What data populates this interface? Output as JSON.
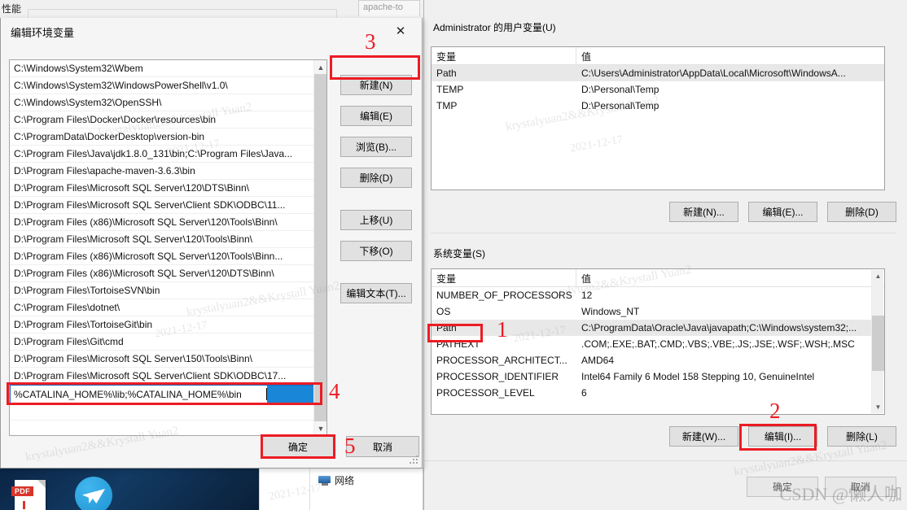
{
  "background": {
    "perf_label": "性能",
    "tab_label": "apache-to",
    "explorer_tree_item": "网络",
    "pdf_icon_label": "PDF"
  },
  "env_dialog": {
    "user_group_label": "Administrator 的用户变量(U)",
    "system_group_label": "系统变量(S)",
    "columns": {
      "variable": "变量",
      "value": "值"
    },
    "user_variables": [
      {
        "name": "Path",
        "value": "C:\\Users\\Administrator\\AppData\\Local\\Microsoft\\WindowsA...",
        "selected": true
      },
      {
        "name": "TEMP",
        "value": "D:\\Personal\\Temp",
        "selected": false
      },
      {
        "name": "TMP",
        "value": "D:\\Personal\\Temp",
        "selected": false
      }
    ],
    "user_buttons": {
      "new": "新建(N)...",
      "edit": "编辑(E)...",
      "delete": "删除(D)"
    },
    "system_variables": [
      {
        "name": "NUMBER_OF_PROCESSORS",
        "value": "12",
        "selected": false
      },
      {
        "name": "OS",
        "value": "Windows_NT",
        "selected": false
      },
      {
        "name": "Path",
        "value": "C:\\ProgramData\\Oracle\\Java\\javapath;C:\\Windows\\system32;...",
        "selected": true
      },
      {
        "name": "PATHEXT",
        "value": ".COM;.EXE;.BAT;.CMD;.VBS;.VBE;.JS;.JSE;.WSF;.WSH;.MSC",
        "selected": false
      },
      {
        "name": "PROCESSOR_ARCHITECT...",
        "value": "AMD64",
        "selected": false
      },
      {
        "name": "PROCESSOR_IDENTIFIER",
        "value": "Intel64 Family 6 Model 158 Stepping 10, GenuineIntel",
        "selected": false
      },
      {
        "name": "PROCESSOR_LEVEL",
        "value": "6",
        "selected": false
      }
    ],
    "system_buttons": {
      "new": "新建(W)...",
      "edit": "编辑(I)...",
      "delete": "删除(L)"
    },
    "footer_buttons": {
      "ok": "确定",
      "cancel": "取消"
    }
  },
  "edit_dialog": {
    "title": "编辑环境变量",
    "close_icon": "✕",
    "path_entries": [
      "C:\\Windows\\System32\\Wbem",
      "C:\\Windows\\System32\\WindowsPowerShell\\v1.0\\",
      "C:\\Windows\\System32\\OpenSSH\\",
      "C:\\Program Files\\Docker\\Docker\\resources\\bin",
      "C:\\ProgramData\\DockerDesktop\\version-bin",
      "C:\\Program Files\\Java\\jdk1.8.0_131\\bin;C:\\Program Files\\Java...",
      "D:\\Program Files\\apache-maven-3.6.3\\bin",
      "D:\\Program Files\\Microsoft SQL Server\\120\\DTS\\Binn\\",
      "D:\\Program Files\\Microsoft SQL Server\\Client SDK\\ODBC\\11...",
      "D:\\Program Files (x86)\\Microsoft SQL Server\\120\\Tools\\Binn\\",
      "D:\\Program Files\\Microsoft SQL Server\\120\\Tools\\Binn\\",
      "D:\\Program Files (x86)\\Microsoft SQL Server\\120\\Tools\\Binn...",
      "D:\\Program Files (x86)\\Microsoft SQL Server\\120\\DTS\\Binn\\",
      "D:\\Program Files\\TortoiseSVN\\bin",
      "C:\\Program Files\\dotnet\\",
      "D:\\Program Files\\TortoiseGit\\bin",
      "D:\\Program Files\\Git\\cmd",
      "D:\\Program Files\\Microsoft SQL Server\\150\\Tools\\Binn\\",
      "D:\\Program Files\\Microsoft SQL Server\\Client SDK\\ODBC\\17..."
    ],
    "editing_value": "%CATALINA_HOME%\\lib;%CATALINA_HOME%\\bin",
    "side_buttons": {
      "new": "新建(N)",
      "edit": "编辑(E)",
      "browse": "浏览(B)...",
      "delete": "删除(D)",
      "move_up": "上移(U)",
      "move_down": "下移(O)",
      "edit_text": "编辑文本(T)..."
    },
    "footer_buttons": {
      "ok": "确定",
      "cancel": "取消"
    }
  },
  "annotations": {
    "n1": "1",
    "n2": "2",
    "n3": "3",
    "n4": "4",
    "n5": "5",
    "accent_color": "#ec1c24"
  },
  "watermarks": {
    "csdn": "CSDN @懒人咖",
    "text_a": "krystalyuan2&&Krystall Yuan2",
    "text_b": "2021-12-17"
  }
}
